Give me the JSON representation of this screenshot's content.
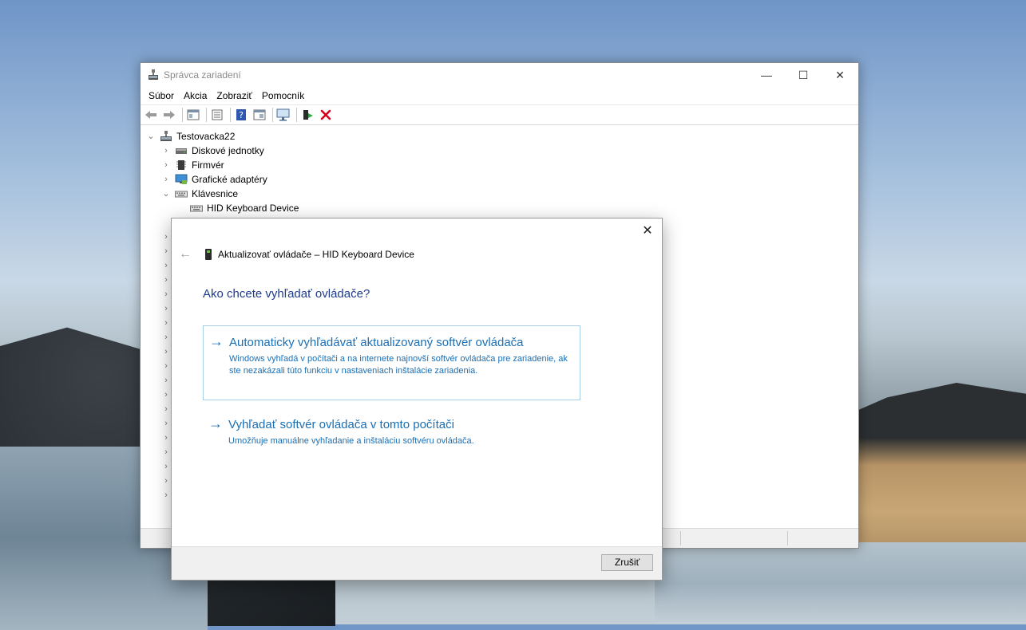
{
  "window": {
    "title": "Správca zariadení",
    "controls": {
      "minimize": "—",
      "maximize": "☐",
      "close": "✕"
    }
  },
  "menu": [
    "Súbor",
    "Akcia",
    "Zobraziť",
    "Pomocník"
  ],
  "toolbar": {
    "icons": [
      "back-arrow-icon",
      "forward-arrow-icon",
      "show-hide-tree-icon",
      "properties-icon",
      "help-icon",
      "view-icon",
      "scan-hardware-icon",
      "update-driver-icon",
      "uninstall-icon"
    ]
  },
  "tree": {
    "root": "Testovacka22",
    "items": [
      {
        "label": "Diskové jednotky",
        "expanded": false
      },
      {
        "label": "Firmvér",
        "expanded": false
      },
      {
        "label": "Grafické adaptéry",
        "expanded": false
      },
      {
        "label": "Klávesnice",
        "expanded": true
      }
    ],
    "child": "HID Keyboard Device",
    "collapsed_rows": 19
  },
  "dialog": {
    "close": "✕",
    "back": "←",
    "title": "Aktualizovať ovládače – HID Keyboard Device",
    "heading": "Ako chcete vyhľadať ovládače?",
    "option1": {
      "arrow": "→",
      "title": "Automaticky vyhľadávať aktualizovaný softvér ovládača",
      "desc": "Windows vyhľadá v počítači a na internete najnovší softvér ovládača pre zariadenie, ak ste nezakázali túto funkciu v nastaveniach inštalácie zariadenia."
    },
    "option2": {
      "arrow": "→",
      "title": "Vyhľadať softvér ovládača v tomto počítači",
      "desc": "Umožňuje manuálne vyhľadanie a inštaláciu softvéru ovládača."
    },
    "cancel": "Zrušiť"
  },
  "colors": {
    "link": "#1a6fb5",
    "heading": "#1e3c8c",
    "uninstall_red": "#d9001b"
  }
}
